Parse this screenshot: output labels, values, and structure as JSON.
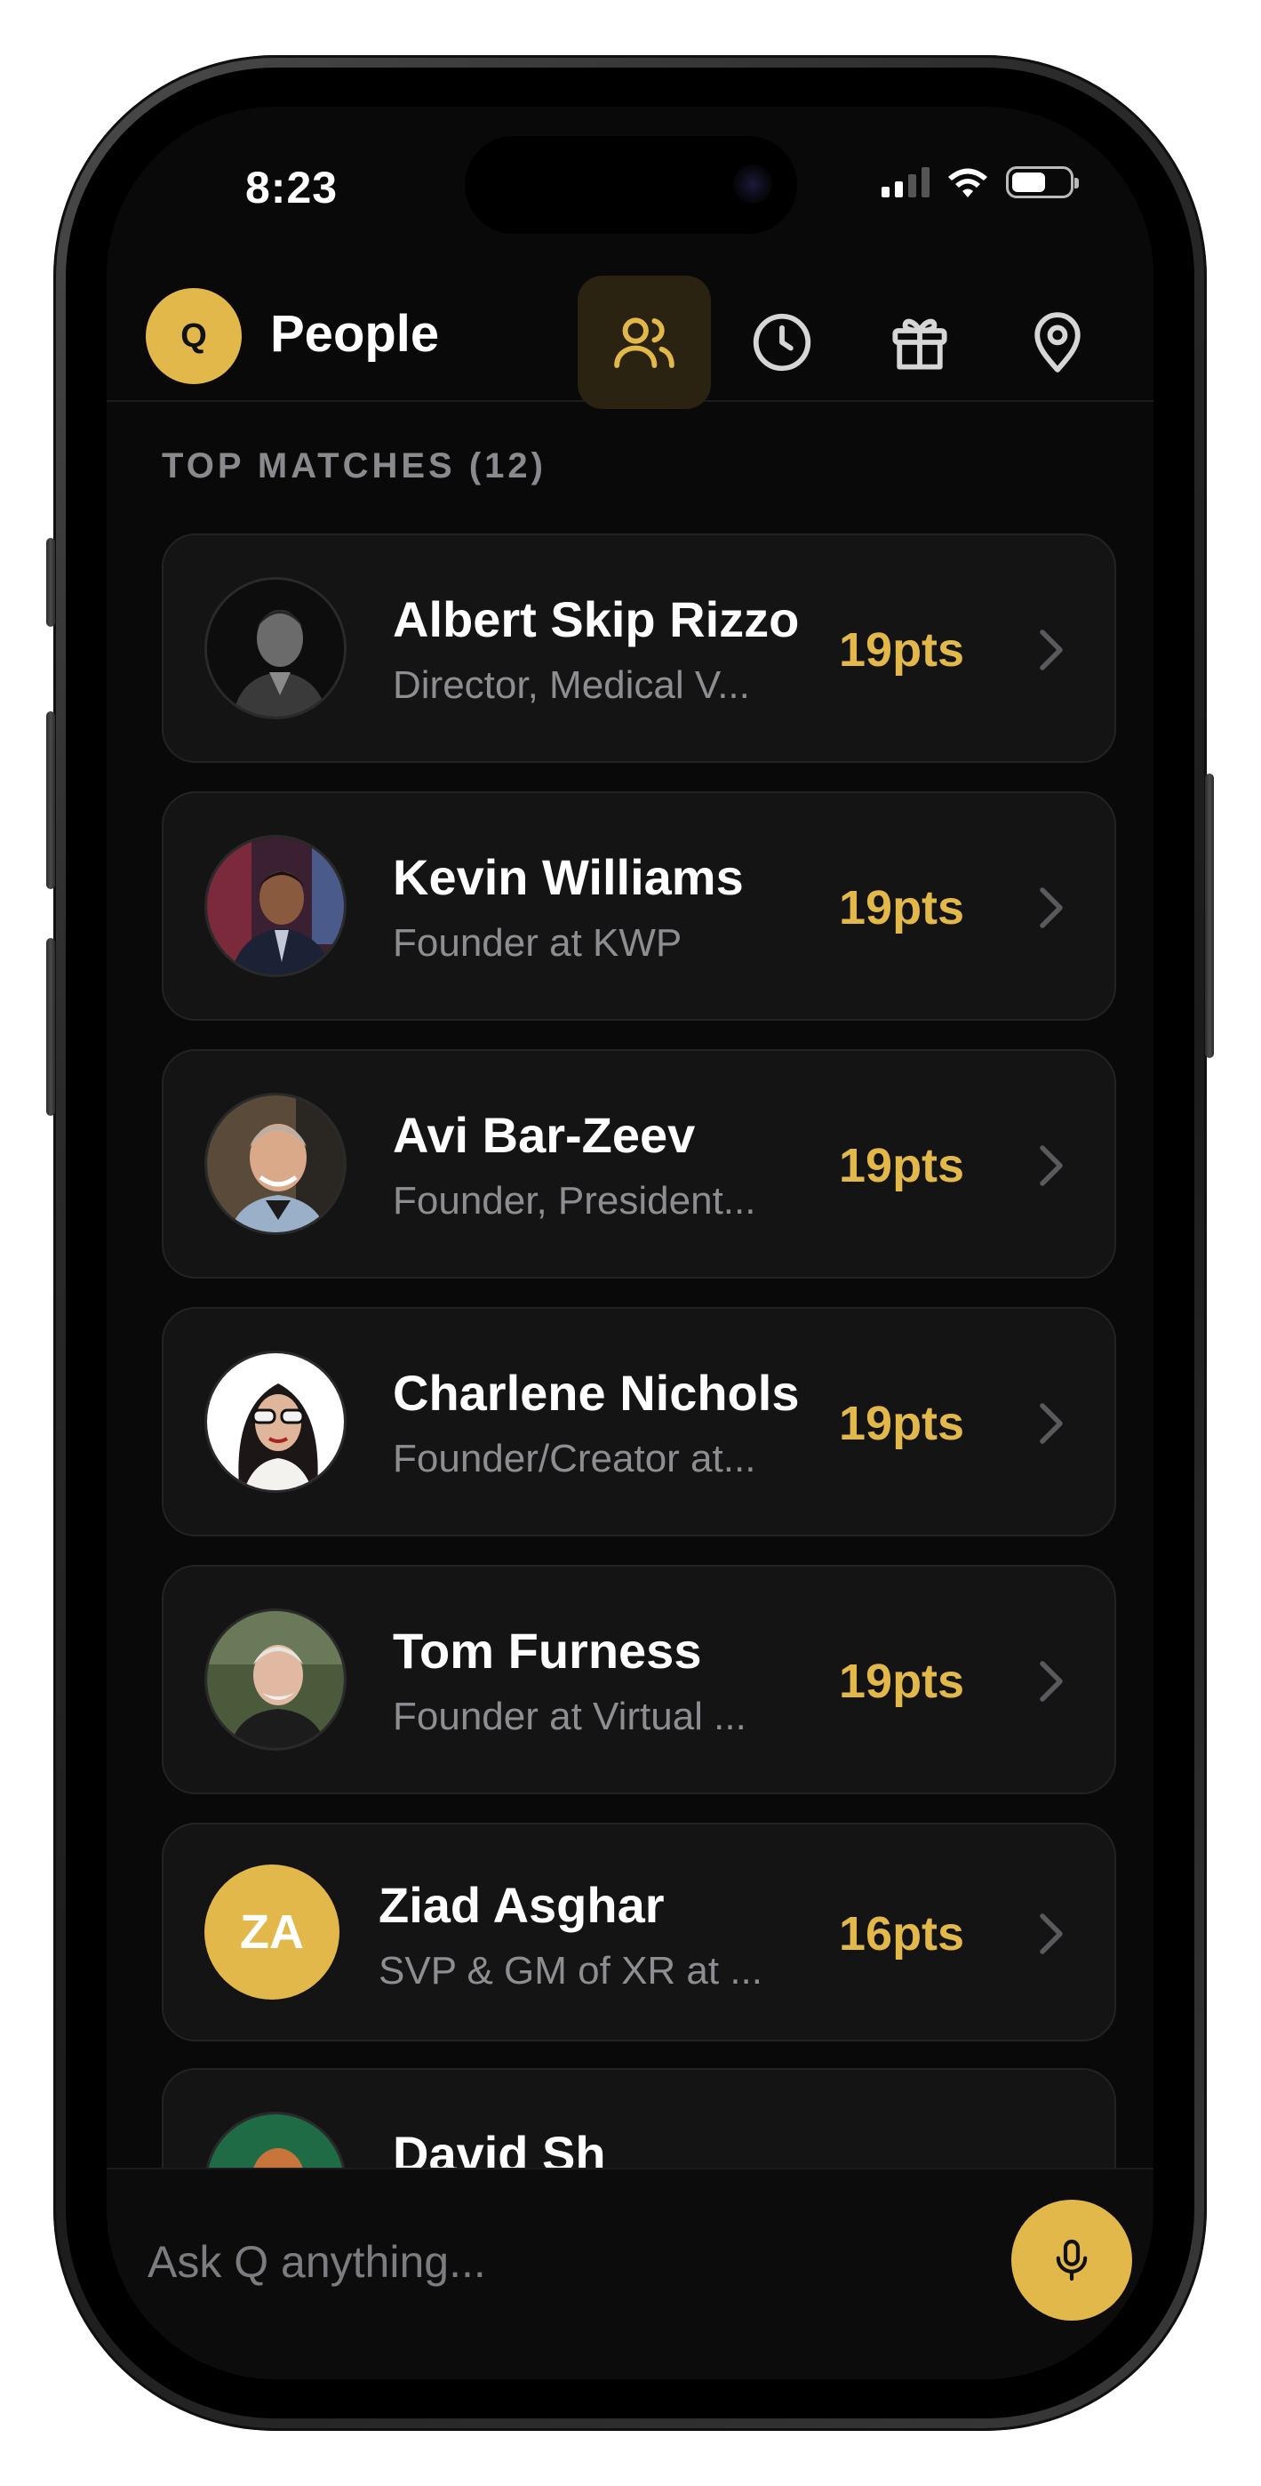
{
  "status_bar": {
    "time": "8:23"
  },
  "header": {
    "logo_letter": "Q",
    "title": "People",
    "nav": [
      {
        "icon": "people-icon",
        "active": true
      },
      {
        "icon": "clock-icon",
        "active": false
      },
      {
        "icon": "gift-icon",
        "active": false
      },
      {
        "icon": "location-pin-icon",
        "active": false
      }
    ]
  },
  "section": {
    "title": "TOP MATCHES (12)"
  },
  "matches": [
    {
      "name": "Albert Skip Rizzo",
      "subtitle": "Director, Medical V...",
      "points": "19pts",
      "avatar": "photo"
    },
    {
      "name": "Kevin Williams",
      "subtitle": "Founder at KWP",
      "points": "19pts",
      "avatar": "photo"
    },
    {
      "name": "Avi Bar-Zeev",
      "subtitle": "Founder, President...",
      "points": "19pts",
      "avatar": "photo"
    },
    {
      "name": "Charlene Nichols",
      "subtitle": "Founder/Creator at...",
      "points": "19pts",
      "avatar": "photo"
    },
    {
      "name": "Tom Furness",
      "subtitle": "Founder at Virtual ...",
      "points": "19pts",
      "avatar": "photo"
    },
    {
      "name": "Ziad Asghar",
      "subtitle": "SVP & GM of XR at ...",
      "points": "16pts",
      "avatar": "initials",
      "initials": "ZA"
    },
    {
      "name": "David Sh",
      "subtitle": "",
      "points": "",
      "avatar": "photo"
    }
  ],
  "ask": {
    "placeholder": "Ask Q anything..."
  },
  "colors": {
    "accent": "#e3b84a",
    "background": "#09090a",
    "card": "#141415"
  }
}
